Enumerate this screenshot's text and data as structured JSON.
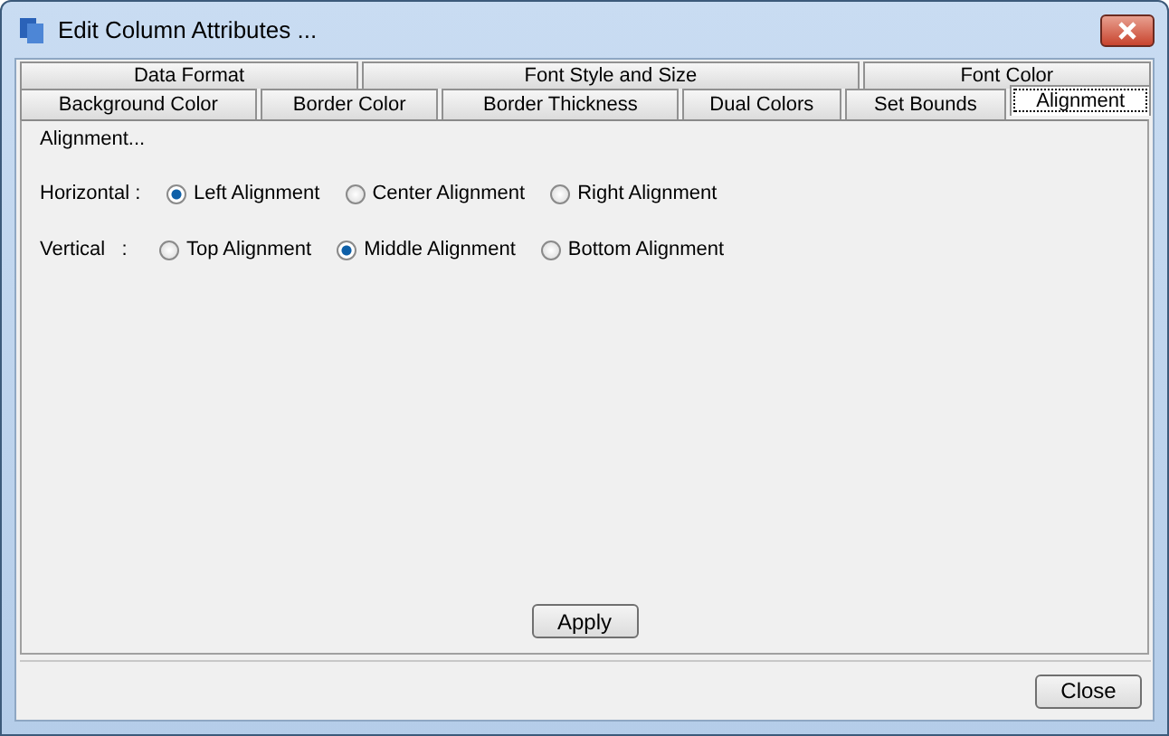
{
  "window": {
    "title": "Edit Column Attributes ..."
  },
  "tab_rows": [
    [
      {
        "label": "Data Format",
        "selected": false
      },
      {
        "label": "Font Style and Size",
        "selected": false
      },
      {
        "label": "Font Color",
        "selected": false
      }
    ],
    [
      {
        "label": "Background Color",
        "selected": false
      },
      {
        "label": "Border Color",
        "selected": false
      },
      {
        "label": "Border Thickness",
        "selected": false
      },
      {
        "label": "Dual Colors",
        "selected": false
      },
      {
        "label": "Set Bounds",
        "selected": false
      },
      {
        "label": "Alignment",
        "selected": true
      }
    ]
  ],
  "group": {
    "title": "Alignment..."
  },
  "rows": [
    {
      "label": "Horizontal :",
      "options": [
        {
          "label": "Left Alignment",
          "selected": true
        },
        {
          "label": "Center Alignment",
          "selected": false
        },
        {
          "label": "Right Alignment",
          "selected": false
        }
      ]
    },
    {
      "label": "Vertical   :",
      "options": [
        {
          "label": "Top Alignment",
          "selected": false
        },
        {
          "label": "Middle Alignment",
          "selected": true
        },
        {
          "label": "Bottom Alignment",
          "selected": false
        }
      ]
    }
  ],
  "apply_button": "Apply",
  "close_button": "Close"
}
